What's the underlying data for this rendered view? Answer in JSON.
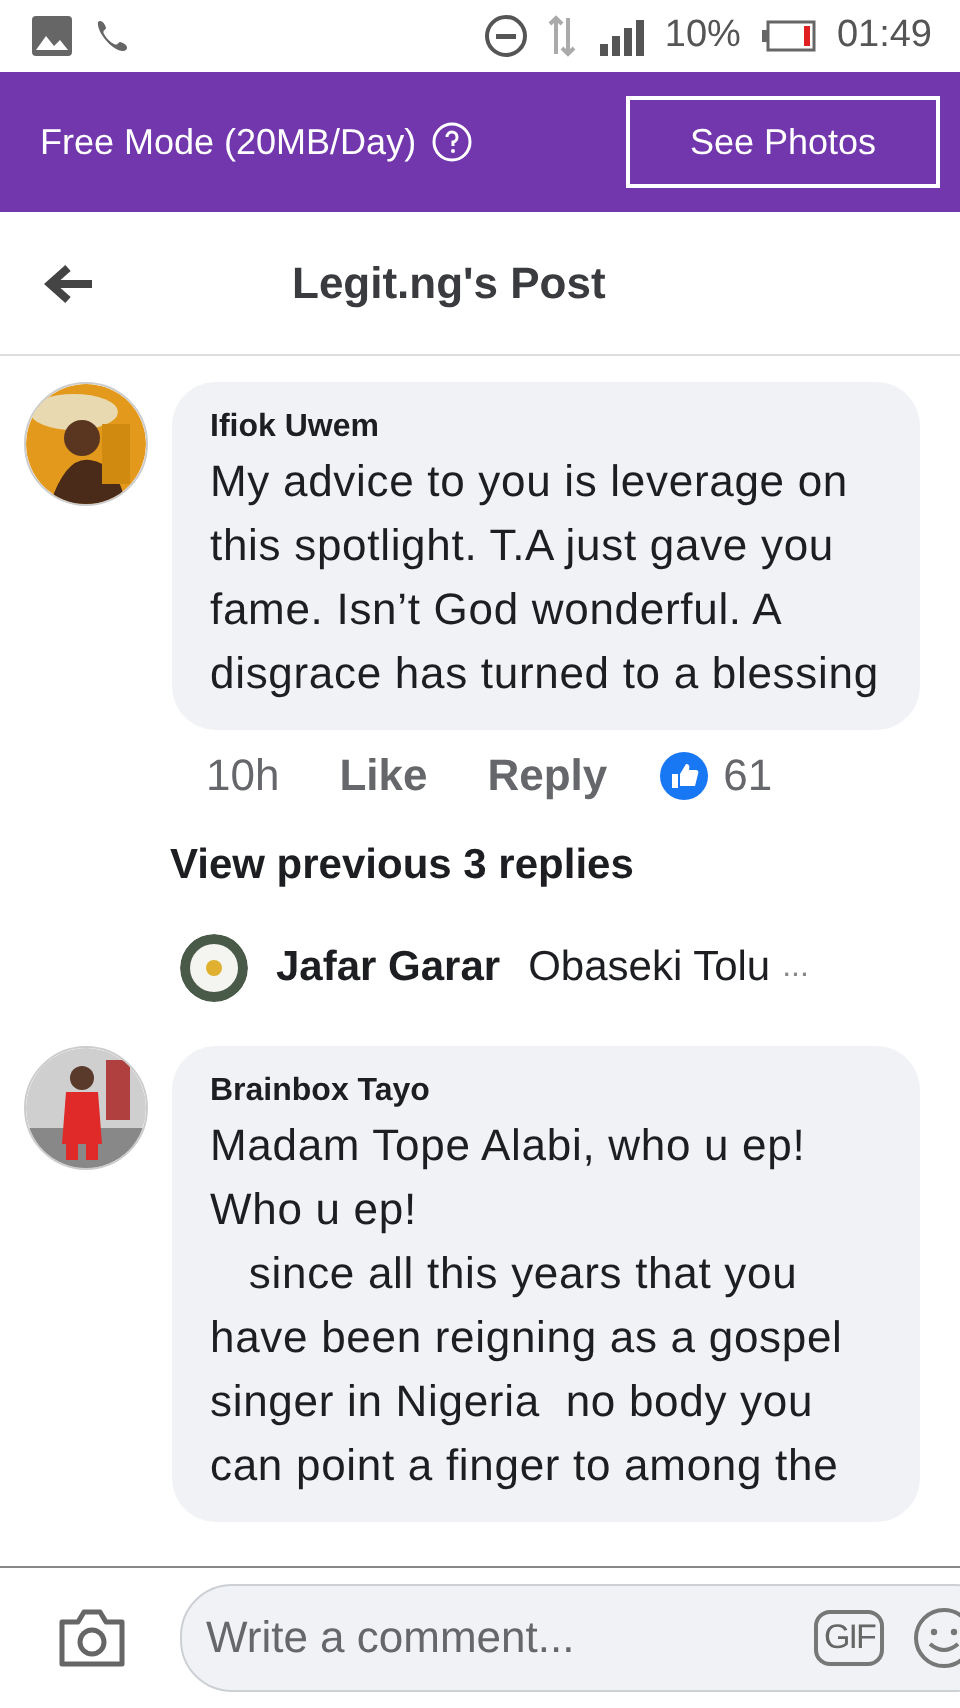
{
  "status_bar": {
    "battery": "10%",
    "time": "01:49"
  },
  "banner": {
    "text": "Free Mode (20MB/Day)",
    "button": "See Photos"
  },
  "header": {
    "title": "Legit.ng's Post"
  },
  "comments": [
    {
      "author": "Ifiok Uwem",
      "text": "My advice to you is leverage on this spotlight. T.A just gave you fame. Isn’t God wonderful. A disgrace has turned to a blessing",
      "time": "10h",
      "like": "Like",
      "reply": "Reply",
      "reactions": "61"
    }
  ],
  "view_previous": "View previous 3 replies",
  "reply_preview": {
    "author": "Jafar Garar",
    "text": "Obaseki Tolu",
    "more": "..."
  },
  "comments_after": [
    {
      "author": "Brainbox Tayo",
      "text": "Madam Tope Alabi, who u ep!\nWho u ep!\n   since all this years that you have been reigning as a gospel singer in Nigeria  no body you can point a finger to among the"
    }
  ],
  "composer": {
    "placeholder": "Write a comment...",
    "gif": "GIF"
  }
}
